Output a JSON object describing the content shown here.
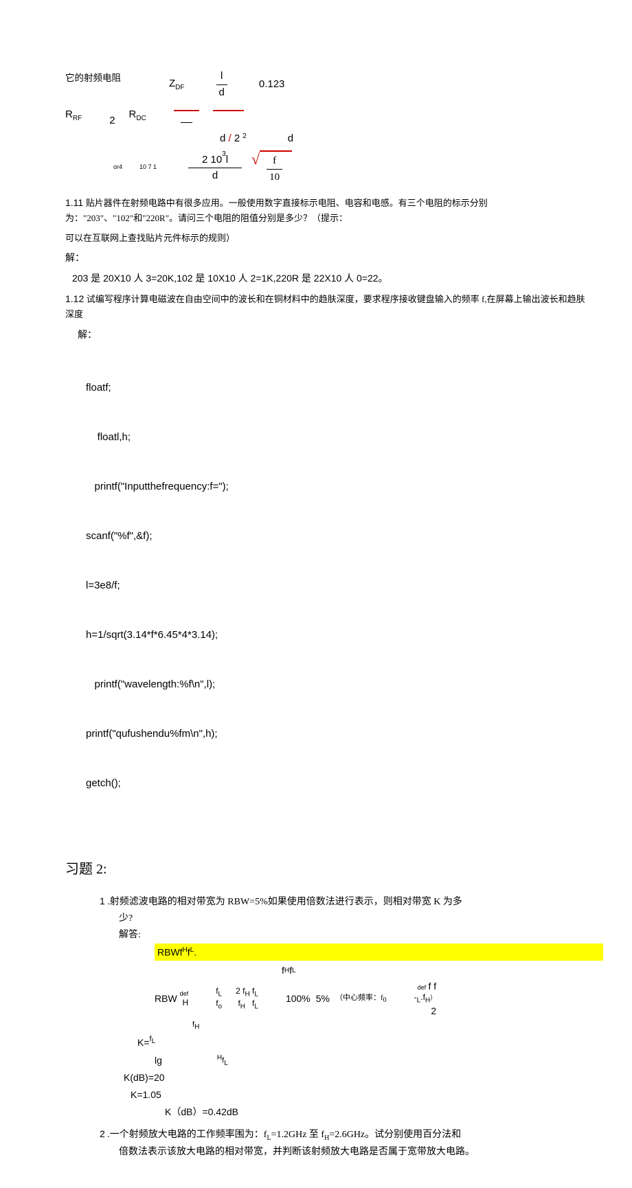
{
  "top": {
    "label_rf": "它的射频电阻",
    "zdf": "Z",
    "zdf_sub": "DF",
    "frac1_top": "l",
    "frac1_bot": "d",
    "val1": "0.123",
    "rrf": "R",
    "rrf_sub": "RF",
    "two": "2",
    "rdc": "R",
    "rdc_sub": "DC",
    "d2": "d",
    "d2_div": "2",
    "exp2": "2",
    "d_right": "d",
    "or4": "or4",
    "tiny": "10 7 1",
    "frac2_top": "2   10",
    "frac2_exp": "3",
    "frac2_top2": "l",
    "frac2_bot": "d",
    "sqrt_top": "f",
    "sqrt_bot": "10"
  },
  "q111": {
    "num": "1.11",
    "text": "贴片器件在射频电路中有很多应用。一般使用数字直接标示电阻、电容和电感。有三个电阻的标示分别为：\"203\"、\"102\"和\"220R\"。请问三个电阻的阻值分别是多少？（提示：",
    "text2": "可以在互联网上查找贴片元件标示的规则）",
    "sol_label": "解：",
    "sol": "203 是 20X10 人 3=20K,102 是 10X10 人 2=1K,220R 是 22X10 人 0=22。"
  },
  "q112": {
    "num": "1.12",
    "text": "试编写程序计算电磁波在自由空间中的波长和在铜材料中的趋肤深度，要求程序接收键盘输入的频率 f,在屏幕上输出波长和趋肤深度",
    "sol_label": "解：",
    "code_lines": [
      "floatf;",
      "    floatl,h;",
      "   printf(\"Inputthefrequency:f=\");",
      "scanf(\"%f\",&f);",
      "l=3e8/f;",
      "h=1/sqrt(3.14*f*6.45*4*3.14);",
      "   printf(\"wavelength:%f\\n\",l);",
      "printf(\"qufushendu%fm\\n\",h);",
      "getch();"
    ]
  },
  "section2_title": "习题 2:",
  "q21": {
    "num": "1",
    "text": ".射频滤波电路的相对带宽为 RBW=5%如果使用倍数法进行表示，则相对带宽 K 为多",
    "text2": "少?",
    "ans_label": "解答:",
    "hl": "RBWf",
    "hl_h": "H",
    "hl_f": "f",
    "hl_l": "L",
    "hl_dot": ".",
    "fh": "f",
    "fh_sub": "H",
    "fl": "f",
    "fl_sub": "L",
    "rbw": "RBW",
    "def": "def",
    "h": "H",
    "two": "2",
    "fo": "f",
    "fo_sub": "o",
    "pct": "100%",
    "five": "5%",
    "center": "（中心频率：f",
    "center_sub": "0",
    "deff": "def",
    "ff": "f f",
    "neg": "-",
    "l": "L",
    "dot": ".",
    "fh2": "f",
    "fh2_sub": "H",
    "paren": "）",
    "k": "K=",
    "lg": "lg",
    "kdb20": "K(dB)=20",
    "k105": "K=1.05",
    "kdb042": "K（dB）=0.42dB"
  },
  "q22": {
    "num": "2",
    "text": ".一个射频放大电路的工作频率围为：f",
    "fl_sub": "L",
    "text2": "=1.2GHz 至 f",
    "fh_sub": "H",
    "text3": "=2.6GHz。试分别使用百分法和",
    "text4": "倍数法表示该放大电路的相对带宽，并判断该射频放大电路是否属于宽带放大电路。"
  }
}
